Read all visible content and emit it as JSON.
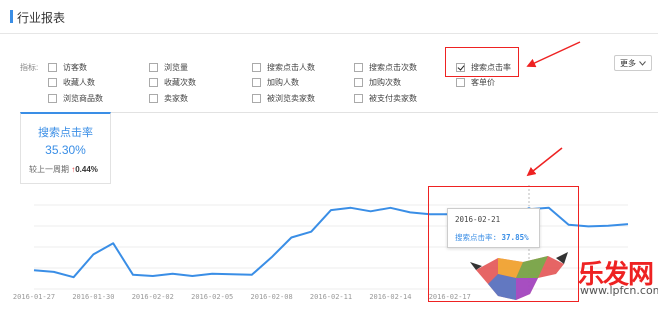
{
  "header": {
    "title": "行业报表"
  },
  "metrics": {
    "label": "指标:",
    "items": [
      {
        "label": "访客数",
        "checked": false
      },
      {
        "label": "浏览量",
        "checked": false
      },
      {
        "label": "搜索点击人数",
        "checked": false
      },
      {
        "label": "搜索点击次数",
        "checked": false
      },
      {
        "label": "搜索点击率",
        "checked": true
      },
      {
        "label": "收藏人数",
        "checked": false
      },
      {
        "label": "收藏次数",
        "checked": false
      },
      {
        "label": "加购人数",
        "checked": false
      },
      {
        "label": "加购次数",
        "checked": false
      },
      {
        "label": "客单价",
        "checked": false
      },
      {
        "label": "浏览商品数",
        "checked": false
      },
      {
        "label": "卖家数",
        "checked": false
      },
      {
        "label": "被浏览卖家数",
        "checked": false
      },
      {
        "label": "被支付卖家数",
        "checked": false
      }
    ],
    "more_label": "更多"
  },
  "stat_card": {
    "name": "搜索点击率",
    "value": "35.30%",
    "compare_label": "较上一周期",
    "change": "0.44%",
    "change_direction": "up"
  },
  "tooltip": {
    "date": "2016-02-21",
    "series_label": "搜索点击率:",
    "value": "37.85%"
  },
  "watermark": {
    "brand": "乐发网",
    "url": "www.lpfcn.com"
  },
  "colors": {
    "accent": "#3a8ee6",
    "highlight": "#e22222",
    "up": "#e33333"
  },
  "chart_data": {
    "type": "line",
    "x_ticks": [
      "2016-01-27",
      "2016-01-30",
      "2016-02-02",
      "2016-02-05",
      "2016-02-08",
      "2016-02-11",
      "2016-02-14",
      "2016-02-17"
    ],
    "series": [
      {
        "name": "搜索点击率",
        "x": [
          "2016-01-27",
          "2016-01-28",
          "2016-01-29",
          "2016-01-30",
          "2016-01-31",
          "2016-02-01",
          "2016-02-02",
          "2016-02-03",
          "2016-02-04",
          "2016-02-05",
          "2016-02-06",
          "2016-02-07",
          "2016-02-08",
          "2016-02-09",
          "2016-02-10",
          "2016-02-11",
          "2016-02-12",
          "2016-02-13",
          "2016-02-14",
          "2016-02-15",
          "2016-02-16",
          "2016-02-17",
          "2016-02-18",
          "2016-02-19",
          "2016-02-20",
          "2016-02-21",
          "2016-02-22",
          "2016-02-23",
          "2016-02-24",
          "2016-02-25",
          "2016-02-26"
        ],
        "values": [
          27.4,
          27.1,
          26.2,
          30.1,
          32.0,
          26.6,
          26.4,
          26.8,
          26.4,
          26.8,
          26.7,
          26.6,
          29.6,
          33.0,
          34.0,
          37.7,
          38.1,
          37.5,
          38.1,
          37.3,
          37.0,
          37.0,
          36.6,
          36.3,
          37.1,
          37.85,
          38.1,
          35.2,
          34.9,
          35.0,
          35.3
        ]
      }
    ],
    "highlight_index": 25,
    "ylim": [
      24,
      42
    ],
    "grid": true
  }
}
